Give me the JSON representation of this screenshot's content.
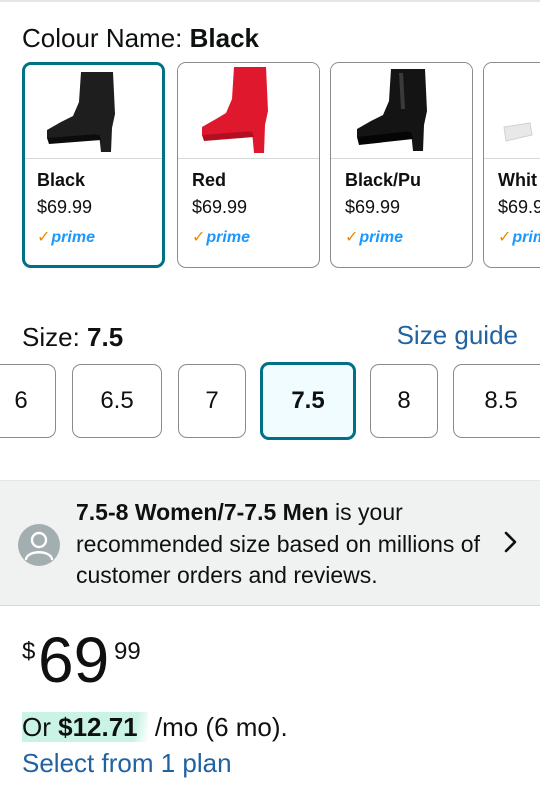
{
  "colour": {
    "label": "Colour Name: ",
    "selected": "Black",
    "swatches": [
      {
        "name": "Black",
        "price": "$69.99",
        "prime": "prime",
        "shoe_color": "#1e1e1e",
        "selected": true
      },
      {
        "name": "Red",
        "price": "$69.99",
        "prime": "prime",
        "shoe_color": "#e0182d",
        "selected": false
      },
      {
        "name": "Black/Pu",
        "price": "$69.99",
        "prime": "prime",
        "shoe_color": "#141414",
        "selected": false
      },
      {
        "name": "Whit",
        "price": "$69.9",
        "prime": "prim",
        "shoe_color": "#f4f4f4",
        "selected": false
      }
    ]
  },
  "size": {
    "label": "Size: ",
    "selected": "7.5",
    "guide_link": "Size guide",
    "options": [
      "6",
      "6.5",
      "7",
      "7.5",
      "8",
      "8.5"
    ]
  },
  "recommendation": {
    "bold": "7.5-8 Women/7-7.5 Men",
    "rest": " is your recommended size based on millions of customer orders and reviews."
  },
  "price": {
    "currency": "$",
    "whole": "69",
    "fraction": "99"
  },
  "installment": {
    "prefix": "Or ",
    "amount": "$12.71",
    "suffix": " /mo (6 mo).",
    "link": "Select from 1 plan"
  },
  "colors": {
    "accent": "#007185",
    "link": "#2162a1",
    "prime_blue": "#1a98ff",
    "prime_check": "#f08804",
    "panel_bg": "#f0f2f2",
    "installment_highlight": "#c9f3e5"
  }
}
